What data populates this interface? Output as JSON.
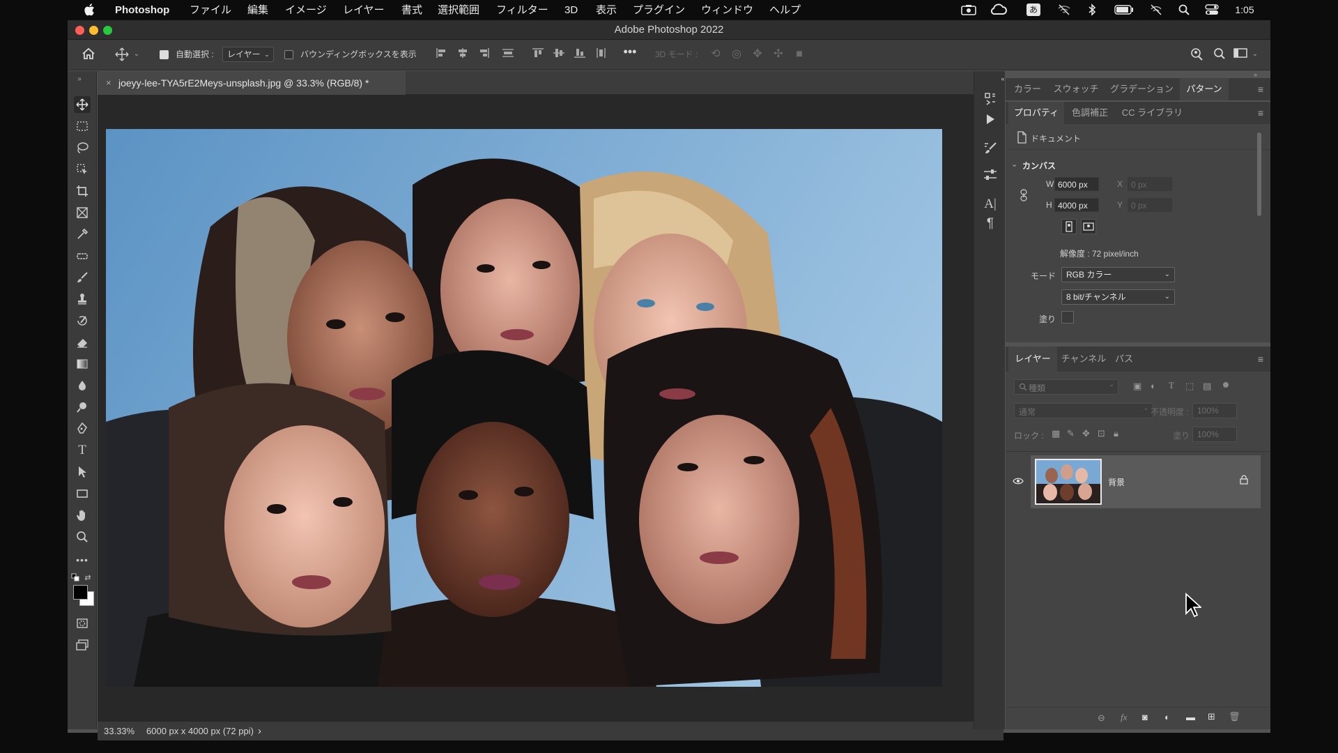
{
  "menubar": {
    "app_name": "Photoshop",
    "items": [
      "ファイル",
      "編集",
      "イメージ",
      "レイヤー",
      "書式",
      "選択範囲",
      "フィルター",
      "3D",
      "表示",
      "プラグイン",
      "ウィンドウ",
      "ヘルプ"
    ],
    "input_mode": "あ",
    "time": "1:05"
  },
  "window": {
    "title": "Adobe Photoshop 2022"
  },
  "options_bar": {
    "auto_select_label": "自動選択 :",
    "auto_select_value": "レイヤー",
    "bounding_box_label": "バウンディングボックスを表示",
    "mode_3d_label": "3D モード :"
  },
  "document": {
    "tab_title": "joeyy-lee-TYA5rE2Meys-unsplash.jpg @ 33.3% (RGB/8) *",
    "tab_close": "×",
    "zoom": "33.33%",
    "doc_info": "6000 px x 4000 px (72 ppi)",
    "info_arrow": "›"
  },
  "panel_top": {
    "tabs": [
      "カラー",
      "スウォッチ",
      "グラデーション",
      "パターン"
    ],
    "active_tab": "パターン"
  },
  "properties": {
    "tabs": [
      "プロパティ",
      "色調補正",
      "CC ライブラリ"
    ],
    "doc_label": "ドキュメント",
    "canvas_section": "カンバス",
    "w_label": "W",
    "w_value": "6000 px",
    "h_label": "H",
    "h_value": "4000 px",
    "x_label": "X",
    "x_value": "0 px",
    "y_label": "Y",
    "y_value": "0 px",
    "resolution": "解像度 : 72 pixel/inch",
    "mode_label": "モード",
    "mode_value": "RGB カラー",
    "bit_value": "8 bit/チャンネル",
    "fill_label": "塗り"
  },
  "layers": {
    "tabs": [
      "レイヤー",
      "チャンネル",
      "パス"
    ],
    "filter_placeholder": "種類",
    "blend_mode": "通常",
    "opacity_label": "不透明度 :",
    "opacity_value": "100%",
    "lock_label": "ロック :",
    "fill_label": "塗り :",
    "fill_value": "100%",
    "layer_name": "背景"
  }
}
